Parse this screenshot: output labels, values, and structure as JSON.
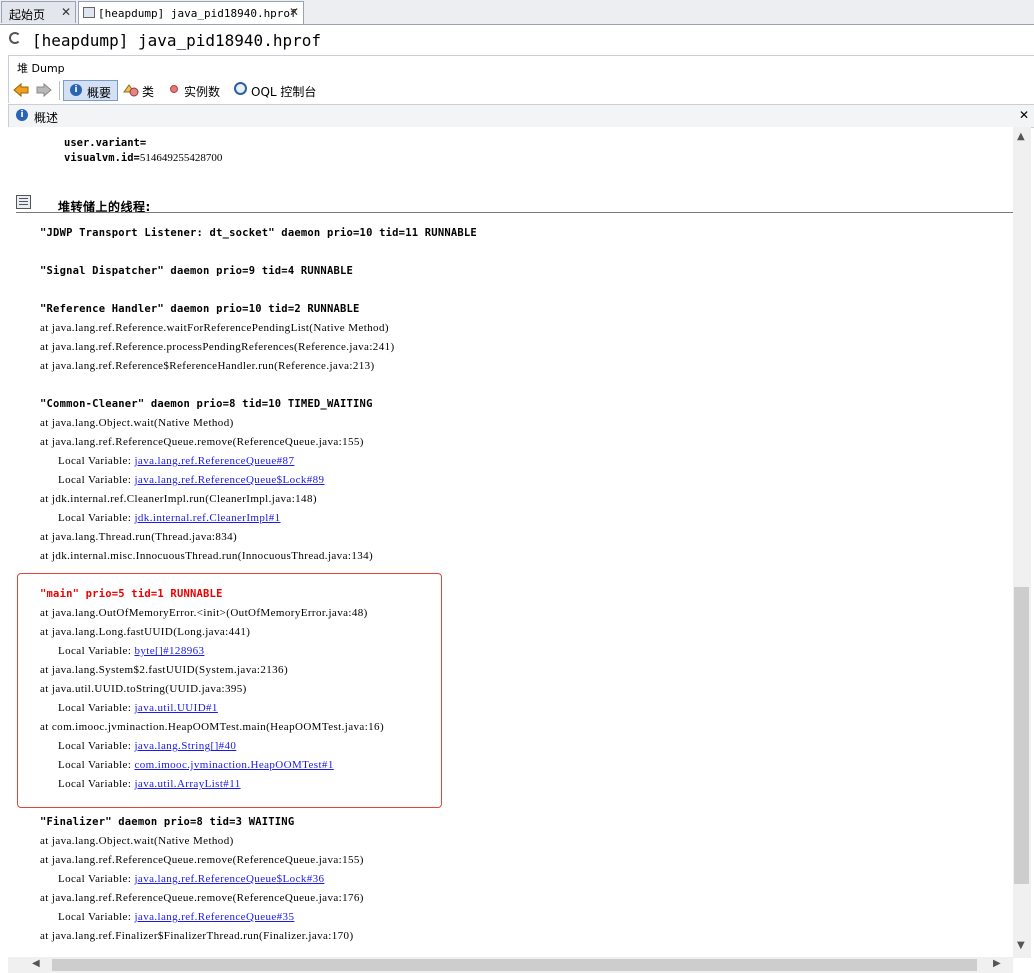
{
  "tabs": [
    {
      "label": "起始页",
      "close": "✕"
    },
    {
      "label": "[heapdump] java_pid18940.hprof",
      "close": "✕"
    }
  ],
  "title": "[heapdump] java_pid18940.hprof",
  "heap_label": "堆 Dump",
  "toolbar": {
    "summary": "概要",
    "classes": "类",
    "instances": "实例数",
    "oql": "OQL 控制台"
  },
  "panel": {
    "title": "概述",
    "close": "✕"
  },
  "sysprops": [
    {
      "key": "user.variant=",
      "value": ""
    },
    {
      "key": "visualvm.id=",
      "value": "514649255428700"
    }
  ],
  "section_title": "堆转储上的线程:",
  "lines": [
    {
      "kind": "thread",
      "text": "\"JDWP Transport Listener: dt_socket\" daemon prio=10 tid=11 RUNNABLE"
    },
    {
      "kind": "thread",
      "text": "\"Signal Dispatcher\" daemon prio=9 tid=4 RUNNABLE"
    },
    {
      "kind": "thread",
      "text": "\"Reference Handler\" daemon prio=10 tid=2 RUNNABLE"
    },
    {
      "kind": "frame",
      "text": "at java.lang.ref.Reference.waitForReferencePendingList(Native Method)"
    },
    {
      "kind": "frame",
      "text": "at java.lang.ref.Reference.processPendingReferences(Reference.java:241)"
    },
    {
      "kind": "frame",
      "text": "at java.lang.ref.Reference$ReferenceHandler.run(Reference.java:213)"
    },
    {
      "kind": "thread",
      "text": "\"Common-Cleaner\" daemon prio=8 tid=10 TIMED_WAITING"
    },
    {
      "kind": "frame",
      "text": "at java.lang.Object.wait(Native Method)"
    },
    {
      "kind": "frame",
      "text": "at java.lang.ref.ReferenceQueue.remove(ReferenceQueue.java:155)"
    },
    {
      "kind": "local",
      "text": "Local Variable: ",
      "link": "java.lang.ref.ReferenceQueue#87"
    },
    {
      "kind": "local",
      "text": "Local Variable: ",
      "link": "java.lang.ref.ReferenceQueue$Lock#89"
    },
    {
      "kind": "frame",
      "text": "at jdk.internal.ref.CleanerImpl.run(CleanerImpl.java:148)"
    },
    {
      "kind": "local",
      "text": "Local Variable: ",
      "link": "jdk.internal.ref.CleanerImpl#1"
    },
    {
      "kind": "frame",
      "text": "at java.lang.Thread.run(Thread.java:834)"
    },
    {
      "kind": "frame",
      "text": "at jdk.internal.misc.InnocuousThread.run(InnocuousThread.java:134)"
    },
    {
      "kind": "thread-red",
      "text": "\"main\" prio=5 tid=1 RUNNABLE"
    },
    {
      "kind": "frame",
      "text": "at java.lang.OutOfMemoryError.<init>(OutOfMemoryError.java:48)"
    },
    {
      "kind": "frame",
      "text": "at java.lang.Long.fastUUID(Long.java:441)"
    },
    {
      "kind": "local",
      "text": "Local Variable: ",
      "link": "byte[]#128963"
    },
    {
      "kind": "frame",
      "text": "at java.lang.System$2.fastUUID(System.java:2136)"
    },
    {
      "kind": "frame",
      "text": "at java.util.UUID.toString(UUID.java:395)"
    },
    {
      "kind": "local",
      "text": "Local Variable: ",
      "link": "java.util.UUID#1"
    },
    {
      "kind": "frame",
      "text": "at com.imooc.jvminaction.HeapOOMTest.main(HeapOOMTest.java:16)"
    },
    {
      "kind": "local",
      "text": "Local Variable: ",
      "link": "java.lang.String[]#40"
    },
    {
      "kind": "local",
      "text": "Local Variable: ",
      "link": "com.imooc.jvminaction.HeapOOMTest#1"
    },
    {
      "kind": "local",
      "text": "Local Variable: ",
      "link": "java.util.ArrayList#11"
    },
    {
      "kind": "thread",
      "text": "\"Finalizer\" daemon prio=8 tid=3 WAITING"
    },
    {
      "kind": "frame",
      "text": "at java.lang.Object.wait(Native Method)"
    },
    {
      "kind": "frame",
      "text": "at java.lang.ref.ReferenceQueue.remove(ReferenceQueue.java:155)"
    },
    {
      "kind": "local",
      "text": "Local Variable: ",
      "link": "java.lang.ref.ReferenceQueue$Lock#36"
    },
    {
      "kind": "frame",
      "text": "at java.lang.ref.ReferenceQueue.remove(ReferenceQueue.java:176)"
    },
    {
      "kind": "local",
      "text": "Local Variable: ",
      "link": "java.lang.ref.ReferenceQueue#35"
    },
    {
      "kind": "frame",
      "text": "at java.lang.ref.Finalizer$FinalizerThread.run(Finalizer.java:170)"
    }
  ],
  "colors": {
    "link": "#1a1aee",
    "main_thread": "#ee0000",
    "highlight_border": "#e0463c"
  }
}
